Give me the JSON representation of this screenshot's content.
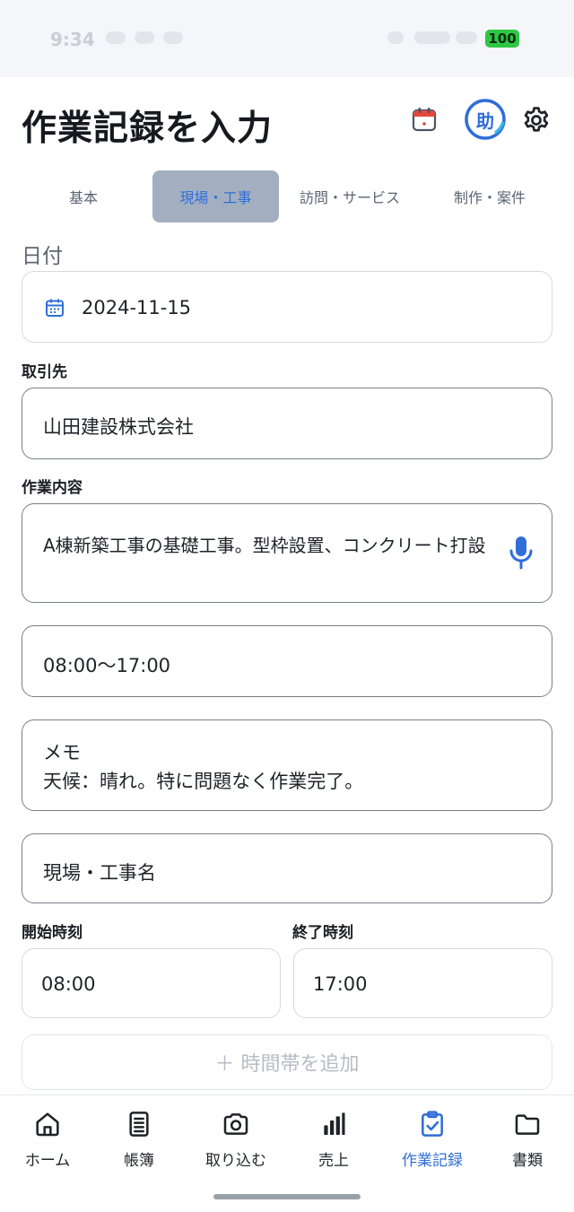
{
  "status_bar": {
    "time": "9:34",
    "battery": "100"
  },
  "header": {
    "title": "作業記録を入力",
    "assist_label": "助"
  },
  "tabs": [
    {
      "label": "基本",
      "active": false
    },
    {
      "label": "現場・工事",
      "active": true
    },
    {
      "label": "訪問・サービス",
      "active": false
    },
    {
      "label": "制作・案件",
      "active": false
    }
  ],
  "form": {
    "date": {
      "label": "日付",
      "value": "2024-11-15"
    },
    "client": {
      "label": "取引先",
      "value": "山田建設株式会社"
    },
    "work": {
      "label": "作業内容",
      "value": "A棟新築工事の基礎工事。型枠設置、コンクリート打設"
    },
    "time_range": {
      "value": "08:00〜17:00"
    },
    "memo": {
      "label": "メモ",
      "value": "天候：晴れ。特に問題なく作業完了。"
    },
    "site": {
      "placeholder": "現場・工事名"
    },
    "start": {
      "label": "開始時刻",
      "value": "08:00"
    },
    "end": {
      "label": "終了時刻",
      "value": "17:00"
    },
    "add_time_slot": "＋ 時間帯を追加"
  },
  "nav": [
    {
      "label": "ホーム",
      "icon": "home-icon",
      "active": false
    },
    {
      "label": "帳簿",
      "icon": "ledger-icon",
      "active": false
    },
    {
      "label": "取り込む",
      "icon": "camera-icon",
      "active": false
    },
    {
      "label": "売上",
      "icon": "bar-chart-icon",
      "active": false
    },
    {
      "label": "作業記録",
      "icon": "clipboard-check-icon",
      "active": true
    },
    {
      "label": "書類",
      "icon": "folder-icon",
      "active": false
    }
  ],
  "colors": {
    "accent": "#2f6ed8",
    "active_tab_bg": "#a3afc0",
    "battery": "#2fc744"
  }
}
